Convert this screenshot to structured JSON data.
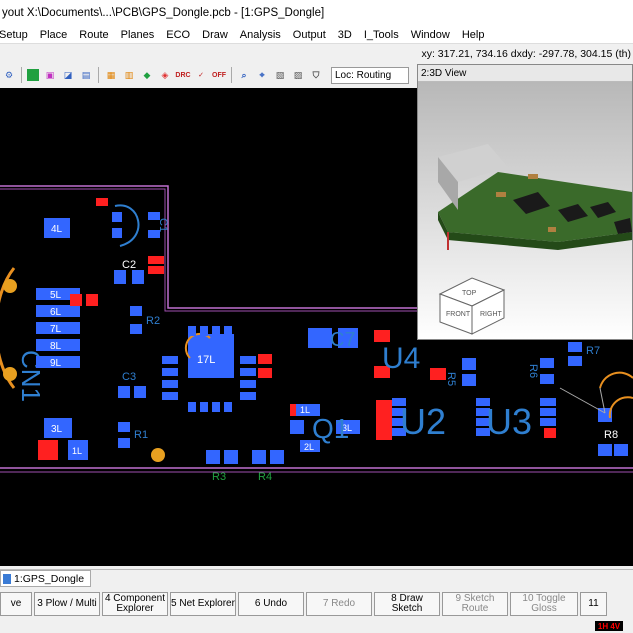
{
  "window": {
    "title": "yout  X:\\Documents\\...\\PCB\\GPS_Dongle.pcb - [1:GPS_Dongle]"
  },
  "menu": [
    "Setup",
    "Place",
    "Route",
    "Planes",
    "ECO",
    "Draw",
    "Analysis",
    "Output",
    "3D",
    "I_Tools",
    "Window",
    "Help"
  ],
  "status": {
    "coords": "xy: 317.21, 734.16  dxdy: -297.78, 304.15  (th)"
  },
  "toolbar": {
    "loc_value": "Loc: Routing"
  },
  "view3d": {
    "title": "2:3D View",
    "cube_top": "TOP",
    "cube_front": "FRONT",
    "cube_right": "RIGHT"
  },
  "pcb": {
    "labels": {
      "c2": "C2",
      "r2": "R2",
      "c3": "C3",
      "r1": "R1",
      "r3": "R3",
      "r4": "R4",
      "c7": "C7",
      "q1": "Q1",
      "u4": "U4",
      "u2": "U2",
      "u3": "U3",
      "r5": "R5",
      "r6": "R6",
      "r7": "R7",
      "r8": "R8",
      "cn1": "CN1",
      "u1": "U1",
      "c1": "C1"
    },
    "pads_left": [
      "5L",
      "6L",
      "7L",
      "8L",
      "9L"
    ],
    "pad_4l": "4L",
    "pad_3l": "3L",
    "pad_1l_left": "1L",
    "pad_1l_small": "1L",
    "pad_2l": "2L",
    "pad_3l_q": "3L",
    "pad_1l_q": "1L",
    "ic_center": "17L"
  },
  "tabs": [
    {
      "label": "1:GPS_Dongle"
    }
  ],
  "fkeys": [
    {
      "label": "ve",
      "dim": false
    },
    {
      "label": "3 Plow / Multi",
      "dim": false
    },
    {
      "label": "4 Component Explorer",
      "dim": false
    },
    {
      "label": "5 Net Explorer",
      "dim": false
    },
    {
      "label": "6 Undo",
      "dim": false
    },
    {
      "label": "7 Redo",
      "dim": true
    },
    {
      "label": "8 Draw Sketch",
      "dim": false
    },
    {
      "label": "9 Sketch Route",
      "dim": true
    },
    {
      "label": "10 Toggle Gloss",
      "dim": true
    },
    {
      "label": "11",
      "dim": false
    }
  ],
  "layer_indicator": "1H 4V",
  "colors": {
    "canvas": "#000000",
    "pad_blue": "#3366ff",
    "pad_red": "#ff2020",
    "silk": "#2f7fd0",
    "outline": "#c070d0",
    "copper_orange": "#e89020"
  }
}
